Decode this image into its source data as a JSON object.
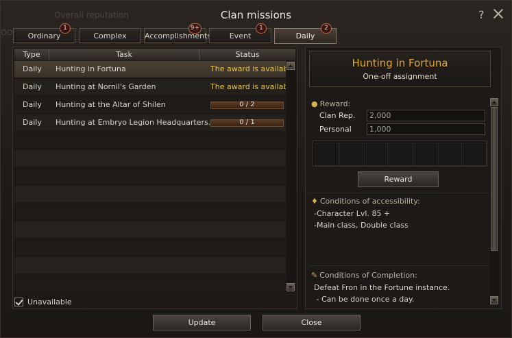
{
  "window": {
    "title": "Clan missions",
    "background_text": "Overall reputation",
    "background_text_2": "OO"
  },
  "tabs": [
    {
      "label": "Ordinary",
      "badge": "1",
      "active": false
    },
    {
      "label": "Complex",
      "badge": "",
      "active": false
    },
    {
      "label": "Accomplishments",
      "badge": "9+",
      "active": false
    },
    {
      "label": "Event",
      "badge": "1",
      "active": false
    },
    {
      "label": "Daily",
      "badge": "2",
      "active": true
    }
  ],
  "table": {
    "headers": {
      "type": "Type",
      "task": "Task",
      "status": "Status"
    },
    "rows": [
      {
        "type": "Daily",
        "task": "Hunting in Fortuna",
        "status": "The award is available",
        "progress": null,
        "selected": true
      },
      {
        "type": "Daily",
        "task": "Hunting at Nornil's Garden",
        "status": "The award is available",
        "progress": null,
        "selected": false
      },
      {
        "type": "Daily",
        "task": "Hunting at the Altar of Shilen",
        "status": "0 / 2",
        "progress": 0.0,
        "selected": false
      },
      {
        "type": "Daily",
        "task": "Hunting at Embryo Legion Headquarters.",
        "status": "0 / 1",
        "progress": 0.0,
        "selected": false
      }
    ]
  },
  "unavailable_checkbox": {
    "label": "Unavailable",
    "checked": true
  },
  "detail": {
    "title": "Hunting in Fortuna",
    "subtitle": "One-off assignment",
    "reward_heading": "Reward:",
    "clan_rep_label": "Clan Rep.",
    "clan_rep_value": "2,000",
    "personal_label": "Personal",
    "personal_value": "1,000",
    "reward_button": "Reward",
    "access_heading": "Conditions of accessibility:",
    "access_line1": "-Character Lvl. 85  +",
    "access_line2": "-Main class, Double class",
    "completion_heading": "Conditions of Completion:",
    "completion_line1": "Defeat Fron in the Fortune instance.",
    "completion_line2": " - Can be done once a day."
  },
  "buttons": {
    "update": "Update",
    "close": "Close"
  },
  "colors": {
    "available": "#e6c64a",
    "detail_title": "#e6a830",
    "badge_border": "#b36a4a"
  }
}
